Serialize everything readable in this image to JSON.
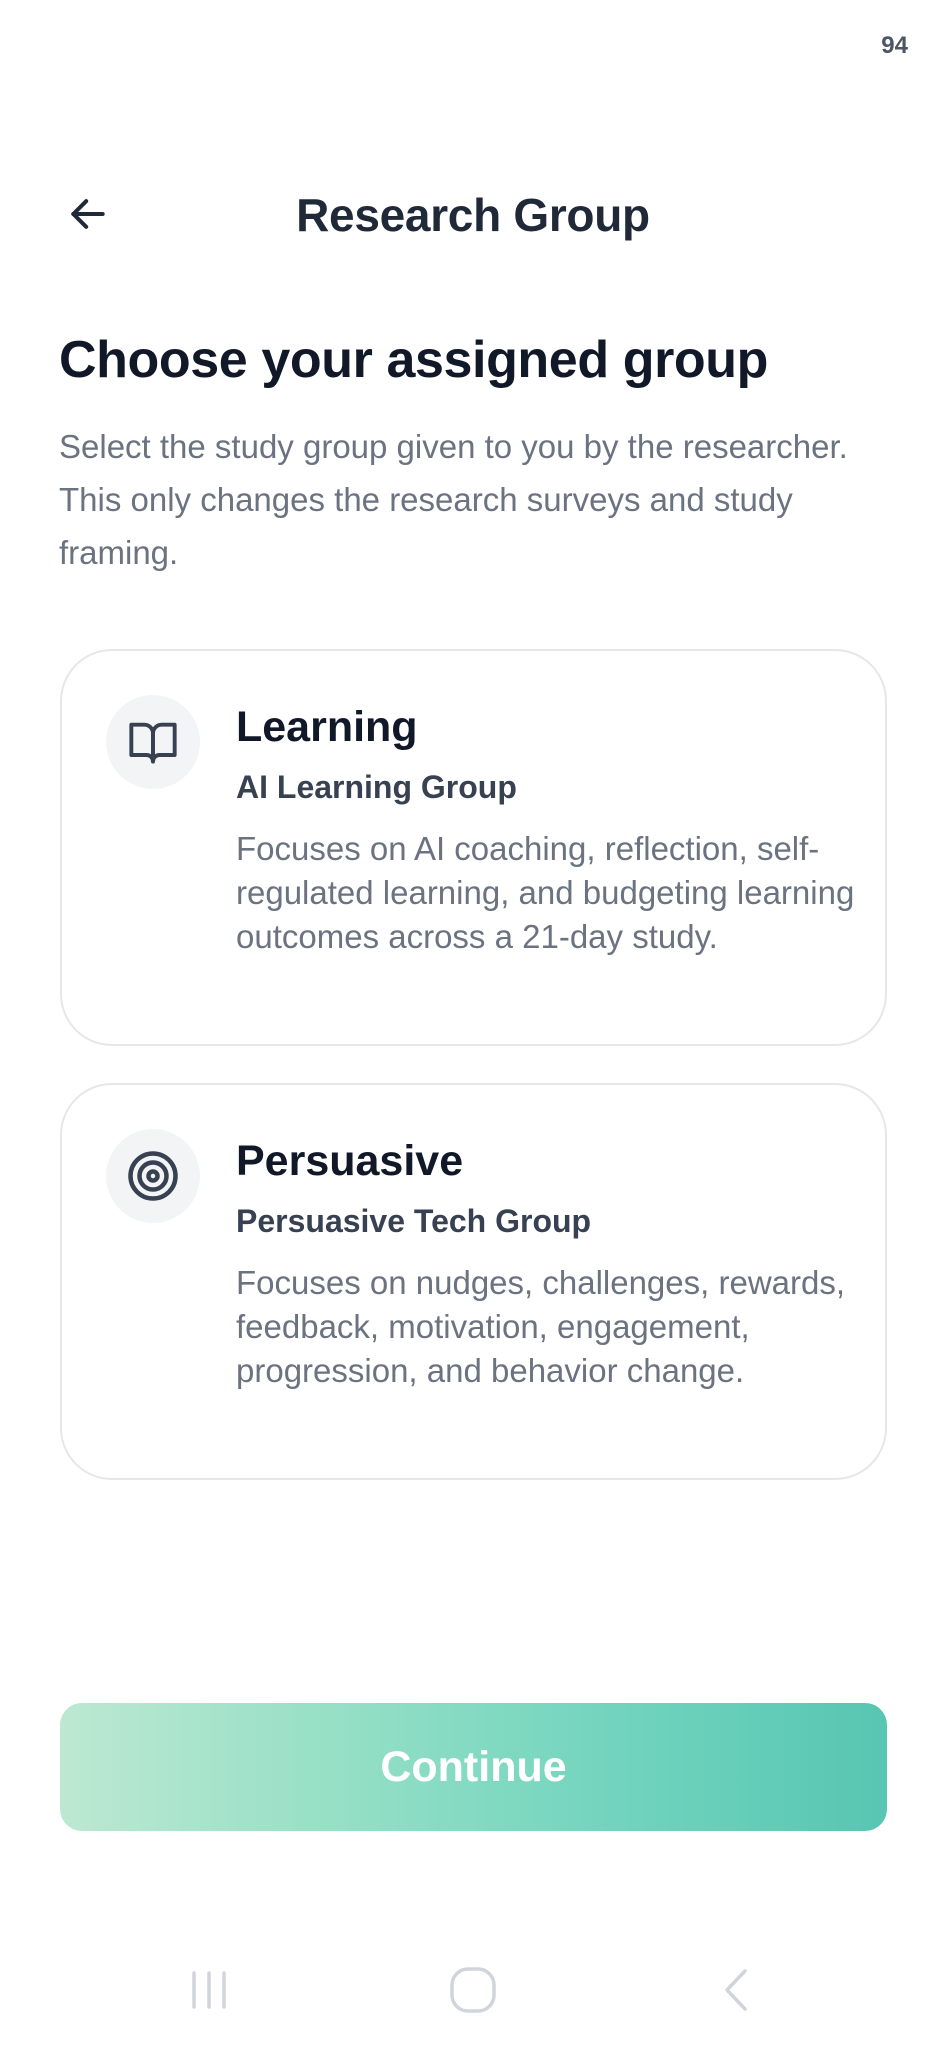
{
  "status_bar": {
    "battery": "94"
  },
  "header": {
    "title": "Research Group",
    "back_icon": "arrow-left-icon"
  },
  "main": {
    "heading": "Choose your assigned group",
    "description": "Select the study group given to you by the researcher. This only changes the research surveys and study framing."
  },
  "groups": [
    {
      "icon": "book-open-icon",
      "title": "Learning",
      "subtitle": "AI Learning Group",
      "description": "Focuses on AI coaching, reflection, self-regulated learning, and budgeting learning outcomes across a 21-day study."
    },
    {
      "icon": "target-icon",
      "title": "Persuasive",
      "subtitle": "Persuasive Tech Group",
      "description": "Focuses on nudges, challenges, rewards, feedback, motivation, engagement, progression, and behavior change."
    }
  ],
  "actions": {
    "continue_label": "Continue"
  },
  "nav_bar": {
    "recents_icon": "recents-icon",
    "home_icon": "home-icon",
    "back_icon": "nav-back-icon"
  },
  "colors": {
    "accent_start": "#bde8d2",
    "accent_end": "#57c6b2",
    "text_primary": "#111827",
    "text_secondary": "#6b7280",
    "card_border": "#e5e7eb"
  }
}
